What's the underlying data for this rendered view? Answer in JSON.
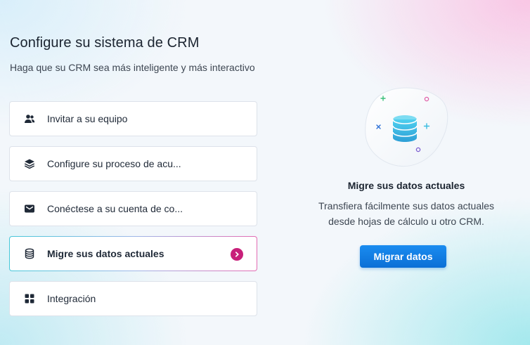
{
  "header": {
    "title": "Configure su sistema de CRM",
    "subtitle": "Haga que su CRM sea más inteligente y más interactivo"
  },
  "steps": [
    {
      "label": "Invitar a su equipo",
      "icon": "users-icon",
      "active": false
    },
    {
      "label": "Configure su proceso de acu...",
      "icon": "layers-icon",
      "active": false
    },
    {
      "label": "Conéctese a su cuenta de co...",
      "icon": "mail-icon",
      "active": false
    },
    {
      "label": "Migre sus datos actuales",
      "icon": "database-icon",
      "active": true
    },
    {
      "label": "Integración",
      "icon": "grid-icon",
      "active": false
    }
  ],
  "detail": {
    "title": "Migre sus datos actuales",
    "description_lines": [
      "Transfiera fácilmente sus datos actuales",
      "desde hojas de cálculo u otro CRM."
    ],
    "button_label": "Migrar datos",
    "illustration": "database-illustration"
  },
  "colors": {
    "accent_pink": "#c81f7a",
    "button_blue": "#0b6fd6",
    "illustration_cyan": "#3bbde0"
  }
}
